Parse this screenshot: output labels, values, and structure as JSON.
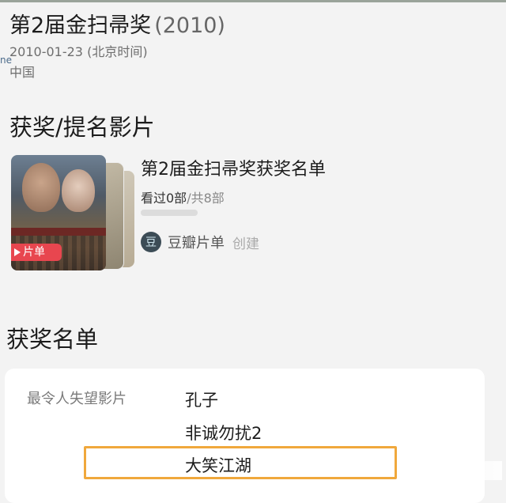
{
  "award": {
    "title": "第2届金扫帚奖",
    "year": "(2010)",
    "date": "2010-01-23 (北京时间)",
    "stray_text": "ne",
    "country": "中国"
  },
  "nominated_section": {
    "title": "获奖/提名影片"
  },
  "list_card": {
    "badge": "片单",
    "title": "第2届金扫帚奖获奖名单",
    "watched": "看过0部",
    "total": "/共8部",
    "progress": 0,
    "creator": "豆瓣片单",
    "creator_action": "创建",
    "avatar_icon": "douban-logo-icon"
  },
  "winners_section": {
    "title": "获奖名单",
    "category": "最令人失望影片",
    "entries": [
      "孔子",
      "非诚勿扰2",
      "大笑江湖"
    ]
  },
  "colors": {
    "accent_red": "#e8464f",
    "highlight_orange": "#f0a83c",
    "progress_green": "#42bd56"
  }
}
